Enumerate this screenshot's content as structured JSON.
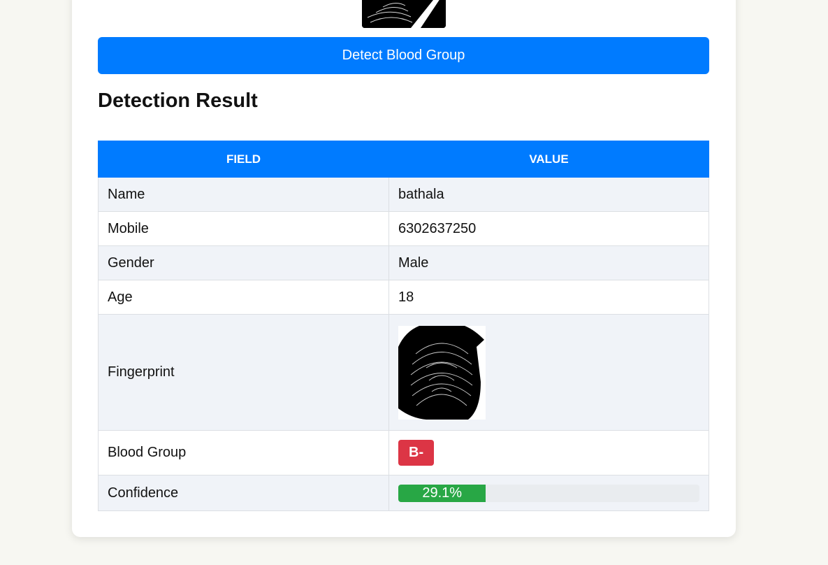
{
  "actions": {
    "detect_button_label": "Detect Blood Group"
  },
  "result": {
    "title": "Detection Result",
    "columns": [
      "Field",
      "Value"
    ],
    "rows": {
      "name": {
        "label": "Name",
        "value": "bathala"
      },
      "mobile": {
        "label": "Mobile",
        "value": "6302637250"
      },
      "gender": {
        "label": "Gender",
        "value": "Male"
      },
      "age": {
        "label": "Age",
        "value": "18"
      },
      "fingerprint": {
        "label": "Fingerprint",
        "image": "fingerprint-image"
      },
      "blood_group": {
        "label": "Blood Group",
        "value": "B-"
      },
      "confidence": {
        "label": "Confidence",
        "value": "29.1%",
        "fraction": 0.291
      }
    }
  },
  "colors": {
    "primary": "#007bff",
    "badge_danger": "#dc3545",
    "progress_success": "#28a745",
    "page_background": "#f7f7f2"
  }
}
